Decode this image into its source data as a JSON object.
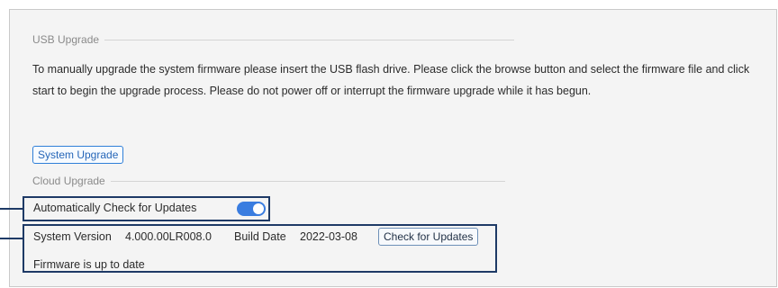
{
  "usb_upgrade": {
    "header": "USB Upgrade",
    "description": "To manually upgrade the system firmware please insert the USB flash drive. Please click the browse button and select the firmware file and click start to begin the upgrade process. Please do not power off or interrupt the firmware upgrade while it has begun.",
    "button_label": "System Upgrade"
  },
  "cloud_upgrade": {
    "header": "Cloud Upgrade",
    "auto_check_label": "Automatically Check for Updates",
    "auto_check_enabled": true,
    "system_version_label": "System Version",
    "system_version_value": "4.000.00LR008.0",
    "build_date_label": "Build Date",
    "build_date_value": "2022-03-08",
    "check_button_label": "Check for Updates",
    "status_text": "Firmware is up to date"
  },
  "colors": {
    "accent": "#3a7de0",
    "highlight": "#1e3a66",
    "panel_bg": "#f4f4f4"
  }
}
